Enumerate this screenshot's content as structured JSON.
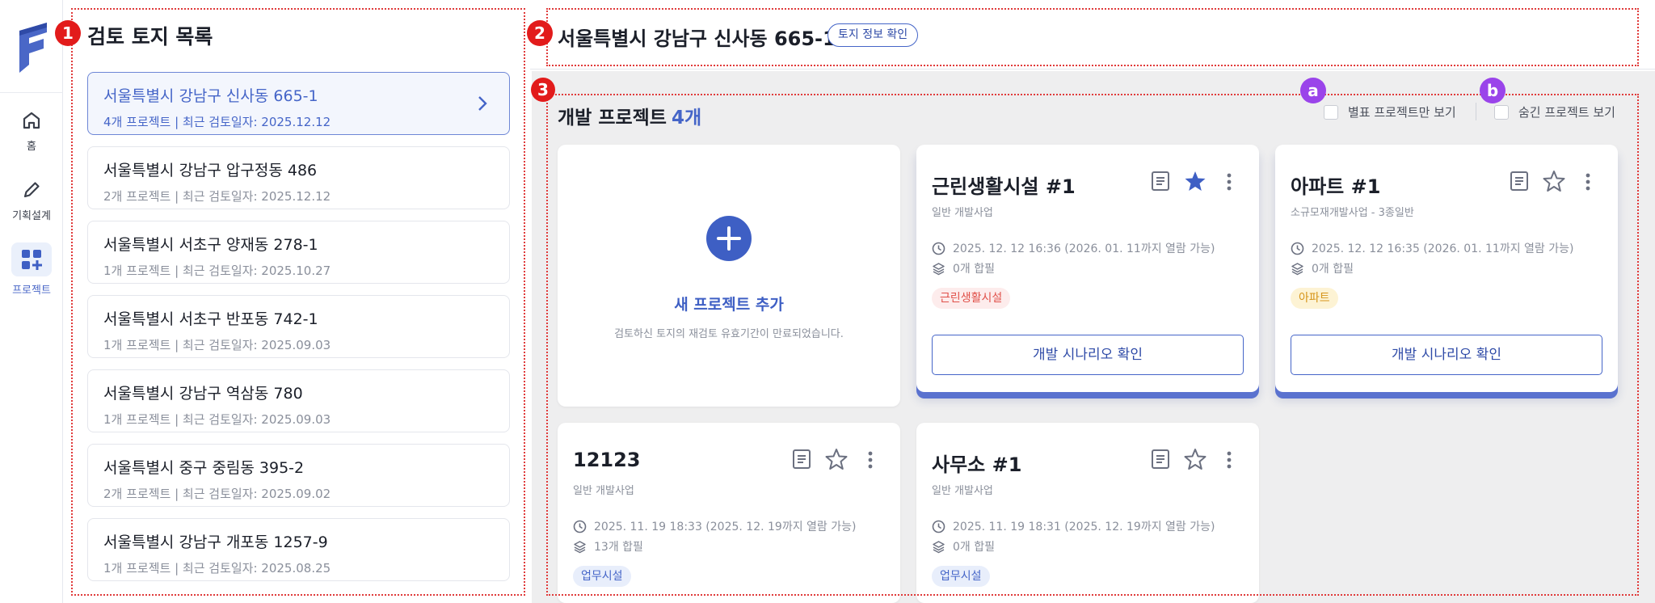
{
  "nav": {
    "items": [
      {
        "label": "홈",
        "icon": "home-icon"
      },
      {
        "label": "기획설계",
        "icon": "pencil-icon"
      },
      {
        "label": "프로젝트",
        "icon": "grid-plus-icon"
      }
    ]
  },
  "land_list": {
    "title": "검토 토지 목록",
    "items": [
      {
        "name": "서울특별시 강남구 신사동 665-1",
        "meta": "4개 프로젝트 | 최근 검토일자: 2025.12.12"
      },
      {
        "name": "서울특별시 강남구 압구정동 486",
        "meta": "2개 프로젝트 | 최근 검토일자: 2025.12.12"
      },
      {
        "name": "서울특별시 서초구 양재동 278-1",
        "meta": "1개 프로젝트 | 최근 검토일자: 2025.10.27"
      },
      {
        "name": "서울특별시 서초구 반포동 742-1",
        "meta": "1개 프로젝트 | 최근 검토일자: 2025.09.03"
      },
      {
        "name": "서울특별시 강남구 역삼동 780",
        "meta": "1개 프로젝트 | 최근 검토일자: 2025.09.03"
      },
      {
        "name": "서울특별시 중구 중림동 395-2",
        "meta": "2개 프로젝트 | 최근 검토일자: 2025.09.02"
      },
      {
        "name": "서울특별시 강남구 개포동 1257-9",
        "meta": "1개 프로젝트 | 최근 검토일자: 2025.08.25"
      }
    ]
  },
  "header": {
    "title": "서울특별시 강남구 신사동 665-1",
    "land_info_button": "토지 정보 확인"
  },
  "projects": {
    "title": "개발 프로젝트",
    "count": "4개",
    "filter_starred": "별표 프로젝트만 보기",
    "filter_hidden": "숨긴 프로젝트 보기",
    "add_card": {
      "label": "새 프로젝트 추가",
      "desc": "검토하신 토지의 재검토 유효기간이 만료되었습니다."
    },
    "cards": [
      {
        "name": "근린생활시설 #1",
        "type": "일반 개발사업",
        "time": "2025. 12. 12 16:36 (2026. 01. 11까지 열람 가능)",
        "merge": "0개 합필",
        "tag": "근린생활시설",
        "button": "개발 시나리오 확인"
      },
      {
        "name": "아파트 #1",
        "type": "소규모재개발사업 - 3종일반",
        "time": "2025. 12. 12 16:35 (2026. 01. 11까지 열람 가능)",
        "merge": "0개 합필",
        "tag": "아파트",
        "button": "개발 시나리오 확인"
      },
      {
        "name": "12123",
        "type": "일반 개발사업",
        "time": "2025. 11. 19 18:33 (2025. 12. 19까지 열람 가능)",
        "merge": "13개 합필",
        "tag": "업무시설"
      },
      {
        "name": "사무소 #1",
        "type": "일반 개발사업",
        "time": "2025. 11. 19 18:31 (2025. 12. 19까지 열람 가능)",
        "merge": "0개 합필",
        "tag": "업무시설"
      }
    ]
  },
  "annotations": {
    "n1": "1",
    "n2": "2",
    "n3": "3",
    "a": "a",
    "b": "b"
  },
  "colors": {
    "accent": "#4565c8",
    "annotation": "#e21b1b",
    "annotation_sub": "#9a44ea"
  }
}
